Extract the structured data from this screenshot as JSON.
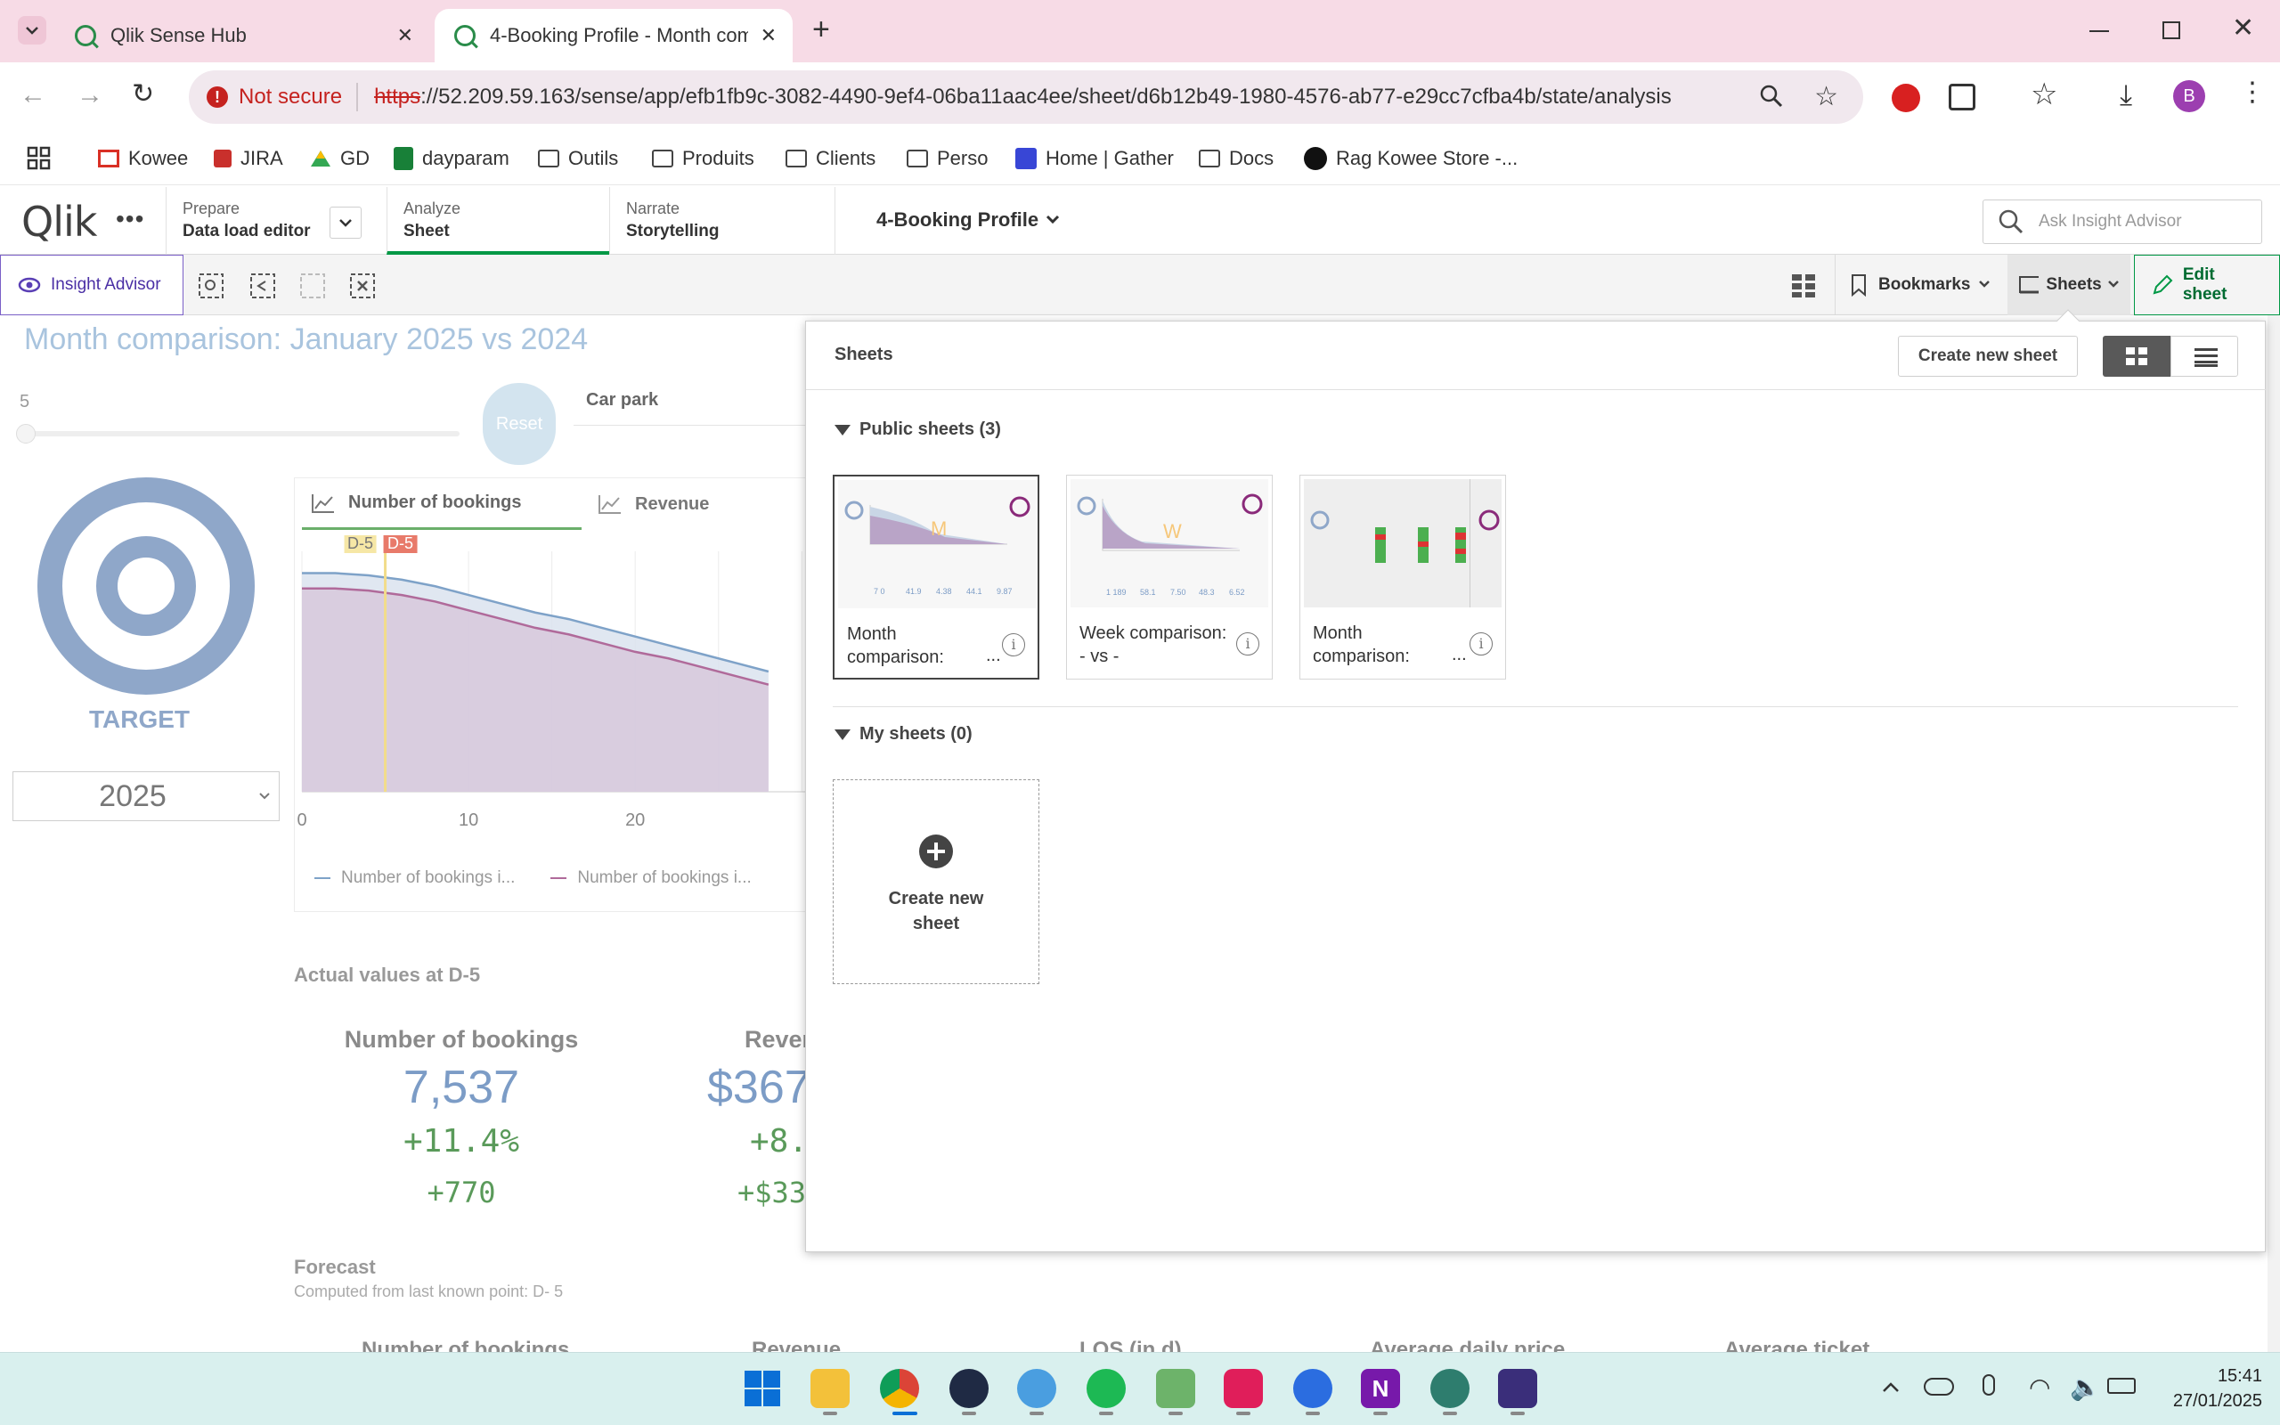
{
  "browser": {
    "tabs": [
      {
        "title": "Qlik Sense Hub"
      },
      {
        "title": "4-Booking Profile - Month com"
      }
    ],
    "security_label": "Not secure",
    "url_scheme": "https",
    "url_rest": "://52.209.59.163/sense/app/efb1fb9c-3082-4490-9ef4-06ba11aac4ee/sheet/d6b12b49-1980-4576-ab77-e29cc7cfba4b/state/analysis",
    "profile_initial": "B",
    "bookmarks": [
      "Kowee",
      "JIRA",
      "GD",
      "dayparam",
      "Outils",
      "Produits",
      "Clients",
      "Perso",
      "Home | Gather",
      "Docs",
      "Rag Kowee Store -..."
    ]
  },
  "qlik": {
    "logo": "Qlik",
    "prepare": {
      "label": "Prepare",
      "sub": "Data load editor"
    },
    "analyze": {
      "label": "Analyze",
      "sub": "Sheet"
    },
    "narrate": {
      "label": "Narrate",
      "sub": "Storytelling"
    },
    "app_title": "4-Booking Profile",
    "search_placeholder": "Ask Insight Advisor",
    "insight_advisor": "Insight Advisor",
    "bookmarks": "Bookmarks",
    "sheets": "Sheets",
    "edit_sheet": "Edit sheet"
  },
  "sheet": {
    "title": "Month comparison: January 2025 vs 2024",
    "slider_value": "5",
    "reset": "Reset",
    "filter_label": "Car park",
    "target_label": "TARGET",
    "year": "2025",
    "chart_tabs": [
      "Number of bookings",
      "Revenue"
    ],
    "marker_labels": [
      "D-5",
      "D-5"
    ],
    "legend": [
      "Number of bookings i...",
      "Number of bookings i..."
    ],
    "actual_title": "Actual values at D-5",
    "kpis": [
      {
        "label": "Number of bookings",
        "value": "7,537",
        "pct": "+11.4%",
        "delta": "+770"
      },
      {
        "label": "Reven",
        "value": "$367",
        "pct": "+8.3",
        "delta": "+$33"
      }
    ],
    "forecast_title": "Forecast",
    "forecast_sub": "Computed from last known point: D- 5",
    "forecast_cols": [
      "Number of bookings",
      "Revenue",
      "LOS (in d)",
      "Average daily price",
      "Average ticket"
    ]
  },
  "chart_data": {
    "type": "area",
    "x_ticks": [
      0,
      10,
      20
    ],
    "xlim": [
      0,
      31
    ],
    "series": [
      {
        "name": "Number of bookings i...",
        "x": [
          0,
          2,
          4,
          6,
          8,
          10,
          12,
          14,
          16,
          18,
          20,
          22,
          24,
          26,
          28
        ],
        "values": [
          100,
          100,
          99,
          97,
          94,
          90,
          86,
          82,
          79,
          75,
          71,
          67,
          63,
          59,
          55
        ]
      },
      {
        "name": "Number of bookings i...",
        "x": [
          0,
          2,
          4,
          6,
          8,
          10,
          12,
          14,
          16,
          18,
          20,
          22,
          24,
          26,
          28
        ],
        "values": [
          93,
          93,
          92,
          90,
          87,
          83,
          79,
          75,
          72,
          68,
          64,
          61,
          57,
          53,
          49
        ]
      }
    ],
    "ylim": [
      0,
      110
    ],
    "marker_x": 5
  },
  "panel": {
    "title": "Sheets",
    "create_button": "Create new sheet",
    "public_header": "Public sheets (3)",
    "public_sheets": [
      {
        "caption": "Month comparison:",
        "ellipsis": "..."
      },
      {
        "caption": "Week comparison: - vs -",
        "ellipsis": ""
      },
      {
        "caption": "Month comparison:",
        "ellipsis": "..."
      }
    ],
    "my_header": "My sheets (0)",
    "create_card": "Create new sheet"
  },
  "taskbar": {
    "time": "15:41",
    "date": "27/01/2025"
  },
  "colors": {
    "qlik_green": "#009845",
    "target_blue": "#8fa7c9",
    "kpi_blue": "#7c9cc6",
    "kpi_green": "#5a9a5a",
    "series1": "#7ea2c8",
    "series2": "#b06a9a"
  }
}
